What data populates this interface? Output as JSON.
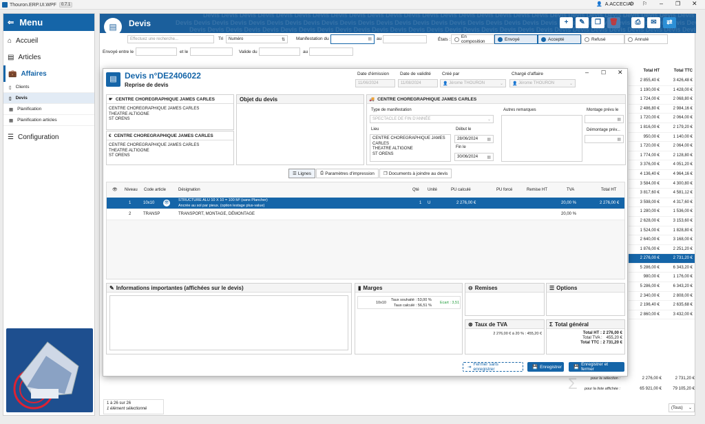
{
  "app": {
    "title": "Thouron.ERP.UI.WPF",
    "version": "0.7.1",
    "user": "A.ACCECIA"
  },
  "nav": {
    "menu_label": "Menu",
    "items": {
      "accueil": "Accueil",
      "articles": "Articles",
      "affaires": "Affaires",
      "clients": "Clients",
      "devis": "Devis",
      "planification": "Planification",
      "planification_articles": "Planification articles",
      "configuration": "Configuration"
    }
  },
  "devis_list": {
    "title": "Devis",
    "watermark": "Devis Devis Devis Devis Devis Devis Devis Devis Devis Devis Devis Devis Devis Devis Devis Devis Devis Devis Devis Devis Devis Devis Devis Devis Devis Devis Devis Devis Devis Devis Devis",
    "search_placeholder": "Effectuez une recherche...",
    "tri_label": "Tri",
    "tri_value": "Numéro",
    "manifestation_label": "Manifestation du",
    "au_label": "au",
    "etats_label": "États :",
    "etats": {
      "composition": "En composition",
      "envoye": "Envoyé",
      "accepte": "Accepté",
      "refuse": "Refusé",
      "annule": "Annulé"
    },
    "envoye_label": "Envoyé entre le",
    "et_le_label": "et le",
    "valide_label": "Valide du",
    "valide_au_label": "au",
    "col_ht": "Total HT",
    "col_ttc": "Total TTC",
    "totals_ht": [
      "2 855,40 €",
      "1 190,00 €",
      "1 724,00 €",
      "2 486,80 €",
      "1 720,00 €",
      "1 816,00 €",
      "950,00 €",
      "1 720,00 €",
      "1 774,00 €",
      "3 376,00 €",
      "4 136,40 €",
      "3 584,00 €",
      "3 817,60 €",
      "3 598,00 €",
      "1 280,00 €",
      "2 628,00 €",
      "1 524,00 €",
      "2 640,00 €",
      "1 876,00 €",
      "2 276,00 €",
      "5 286,00 €",
      "980,00 €",
      "5 286,00 €",
      "2 340,00 €",
      "2 196,40 €",
      "2 860,00 €"
    ],
    "totals_ttc": [
      "3 426,48 €",
      "1 428,00 €",
      "2 068,80 €",
      "2 984,16 €",
      "2 064,00 €",
      "2 179,20 €",
      "1 140,00 €",
      "2 064,00 €",
      "2 128,80 €",
      "4 051,20 €",
      "4 964,16 €",
      "4 300,80 €",
      "4 581,12 €",
      "4 317,60 €",
      "1 536,00 €",
      "3 153,60 €",
      "1 828,80 €",
      "3 168,00 €",
      "2 251,20 €",
      "2 731,20 €",
      "6 343,20 €",
      "1 176,00 €",
      "6 343,20 €",
      "2 808,00 €",
      "2 635,68 €",
      "3 432,00 €"
    ],
    "pour_selection": "pour la sélection :",
    "sel_ht": "2 276,00 €",
    "sel_ttc": "2 731,20 €",
    "pour_liste": "pour la liste affichée :",
    "liste_ht": "65 921,00 €",
    "liste_ttc": "79 105,20 €",
    "count": "1 à 26 sur 26",
    "selected": "1 élément sélectionné",
    "filter": "(Tous)"
  },
  "modal": {
    "title": "Devis n°DE2406022",
    "subtitle": "Reprise de devis",
    "emission_label": "Date d'émission",
    "emission": "11/06/2024",
    "validite_label": "Date de validité",
    "validite": "11/08/2024",
    "cree_par_label": "Créé par",
    "cree_par": "Jérome THOURON",
    "charge_label": "Chargé d'affaire",
    "charge": "Jérome THOURON",
    "client_name": "CENTRE CHOREGRAPHIQUE JAMES CARLES",
    "client_lines": [
      "CENTRE CHOREGRAPHIQUE JAMES CARLES",
      "THEATRE ALTIGONE",
      "ST ORENS"
    ],
    "factu_name": "CENTRE CHOREGRAPHIQUE JAMES CARLES",
    "factu_lines": [
      "CENTRE CHOREGRAPHIQUE JAMES CARLES",
      "THEATRE ALTIGONE",
      "ST ORENS"
    ],
    "objet_label": "Objet du devis",
    "livr_name": "CENTRE CHOREGRAPHIQUE JAMES CARLES",
    "type_label": "Type de manifestation",
    "type_value": "SPECTACLE DE FIN D'ANNÉE",
    "lieu_label": "Lieu",
    "lieu_lines": [
      "CENTRE CHOREGRAPHIQUE JAMES",
      "CARLES",
      "THEATRE ALTIGONE",
      "ST ORENS"
    ],
    "debut_label": "Début le",
    "debut": "28/06/2024",
    "fin_label": "Fin le",
    "fin": "30/06/2024",
    "remarques_label": "Autres remarques",
    "montage_label": "Montage prévu le",
    "demontage_label": "Démontage prév...",
    "tabs": {
      "lignes": "Lignes",
      "impression": "Paramètres d'impression",
      "documents": "Documents à joindre au devis"
    },
    "cols": {
      "niveau": "Niveau",
      "code": "Code article",
      "designation": "Désignation",
      "qte": "Qté",
      "unite": "Unité",
      "pu_calcule": "PU calculé",
      "pu_force": "PU forcé",
      "remise": "Remise HT",
      "tva": "TVA",
      "total": "Total HT"
    },
    "lines": [
      {
        "niveau": "1",
        "code": "10x10",
        "des1": "STRUCTURE ALU 10 X 10 = 100 M² (sans Plancher)",
        "des2": "Ancrée au sol par pieux. (option lestage plus-value)",
        "qte": "1",
        "unite": "U",
        "pu": "2 276,00 €",
        "tva": "20,00 %",
        "total": "2 276,00 €"
      },
      {
        "niveau": "2",
        "code": "TRANSP",
        "des1": "TRANSPORT, MONTAGE, DÉMONTAGE",
        "des2": "",
        "qte": "",
        "unite": "",
        "pu": "",
        "tva": "20,00 %",
        "total": ""
      }
    ],
    "info_label": "Informations importantes (affichées sur le devis)",
    "marges_label": "Marges",
    "marge_code": "10x10",
    "marge_souhaite": "Taux souhaité : 53,00 %",
    "marge_calcule": "Taux calculé : 56,51 %",
    "marge_ecart": "Ecart : 3,51",
    "remises_label": "Remises",
    "options_label": "Options",
    "tva_label": "Taux de TVA",
    "tva_detail": "2 276,00 € à 20 % : 455,20 €",
    "total_label": "Total général",
    "total_ht": "Total HT : 2 276,00 €",
    "total_tva_label": "Total TVA :",
    "total_tva": "455,20 €",
    "total_ttc": "Total TTC : 2 731,20 €",
    "btn_fermer": "Fermer sans enregistrer",
    "btn_enr": "Enregistrer",
    "btn_enr_fermer": "Enregistrer et fermer"
  },
  "colors": {
    "brand": "#1565a8",
    "header": "#1b5f9c",
    "ecart": "#1f9a3a"
  }
}
